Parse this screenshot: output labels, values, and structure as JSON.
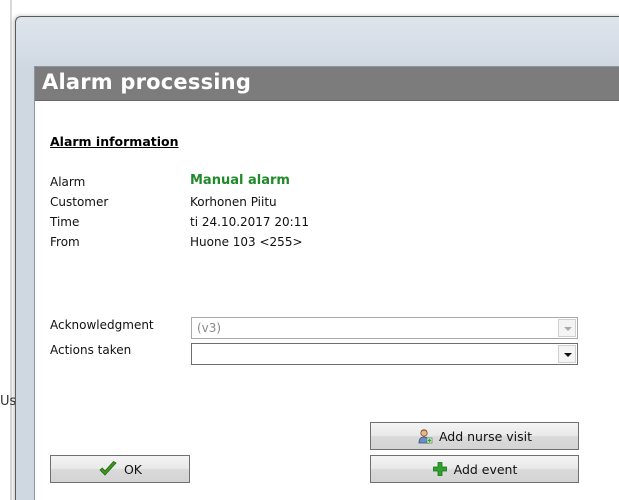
{
  "background": {
    "partial_text": "Us"
  },
  "dialog": {
    "title": "Alarm processing",
    "section_heading": "Alarm information",
    "info": [
      {
        "label": "Alarm",
        "value": "Manual alarm"
      },
      {
        "label": "Customer",
        "value": "Korhonen Piitu"
      },
      {
        "label": "Time",
        "value": "ti 24.10.2017 20:11"
      },
      {
        "label": "From",
        "value": "Huone 103  <255>"
      }
    ],
    "acknowledgment": {
      "label": "Acknowledgment",
      "value": "(v3)",
      "enabled": false
    },
    "actions_taken": {
      "label": "Actions taken",
      "value": ""
    },
    "buttons": {
      "add_nurse_visit": "Add nurse visit",
      "add_event": "Add event",
      "ok": "OK"
    }
  },
  "colors": {
    "title_bar": "#7c7c7c",
    "alarm_value": "#1f8a2a",
    "ok_check": "#3a9a1e",
    "add_plus": "#2ea32e"
  },
  "icons": {
    "ok": "check-icon",
    "add_event": "plus-icon",
    "add_nurse_visit": "nurse-icon"
  }
}
